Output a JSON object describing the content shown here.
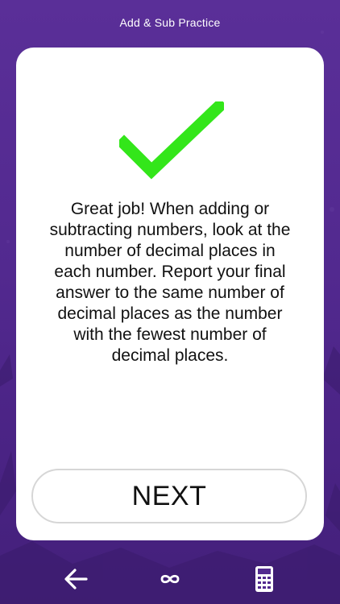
{
  "header": {
    "title": "Add & Sub Practice"
  },
  "feedback": {
    "icon": "checkmark-icon",
    "icon_color": "#33e61a",
    "message": "Great job! When adding or\nsubtracting numbers, look at the\nnumber of decimal places in\neach number.  Report your final\nanswer to the same number of\ndecimal places as the number\nwith the fewest number of\ndecimal places."
  },
  "actions": {
    "next_label": "NEXT"
  },
  "bottom_nav": {
    "back_icon": "back-arrow-icon",
    "infinity_icon": "infinity-icon",
    "calculator_icon": "calculator-icon"
  },
  "colors": {
    "background": "#52298f",
    "card": "#ffffff",
    "accent": "#33e61a"
  }
}
